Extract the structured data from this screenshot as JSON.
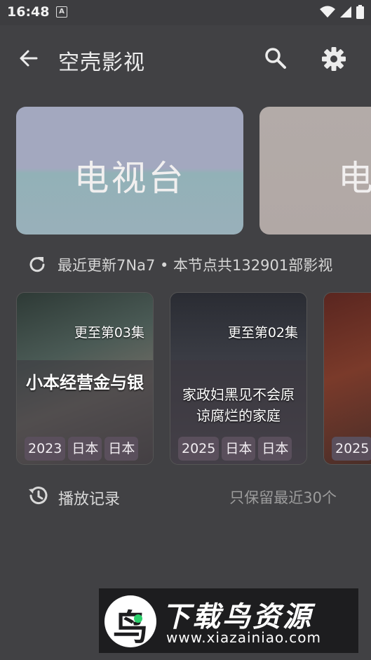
{
  "status_bar": {
    "time": "16:48",
    "notification": "A"
  },
  "app_bar": {
    "title": "空壳影视",
    "back_icon": "arrow-left-icon",
    "search_icon": "search-icon",
    "settings_icon": "gear-icon"
  },
  "categories": [
    {
      "label": "电视台"
    },
    {
      "label": "电"
    }
  ],
  "updates": {
    "text": "最近更新7Na7 • 本节点共132901部影视"
  },
  "movies": [
    {
      "episode": "更至第03集",
      "title": "小本经营金与银",
      "tags": [
        "2023",
        "日本",
        "日本"
      ]
    },
    {
      "episode": "更至第02集",
      "title": "家政妇黑见不会原谅腐烂的家庭",
      "tags": [
        "2025",
        "日本",
        "日本"
      ]
    },
    {
      "episode": "",
      "title": "",
      "tags": [
        "2025"
      ]
    }
  ],
  "history": {
    "label": "播放记录",
    "hint": "只保留最近30个"
  },
  "watermark": {
    "logo": "鸟",
    "title": "下载鸟资源",
    "url": "www.xiazainiao.com"
  }
}
